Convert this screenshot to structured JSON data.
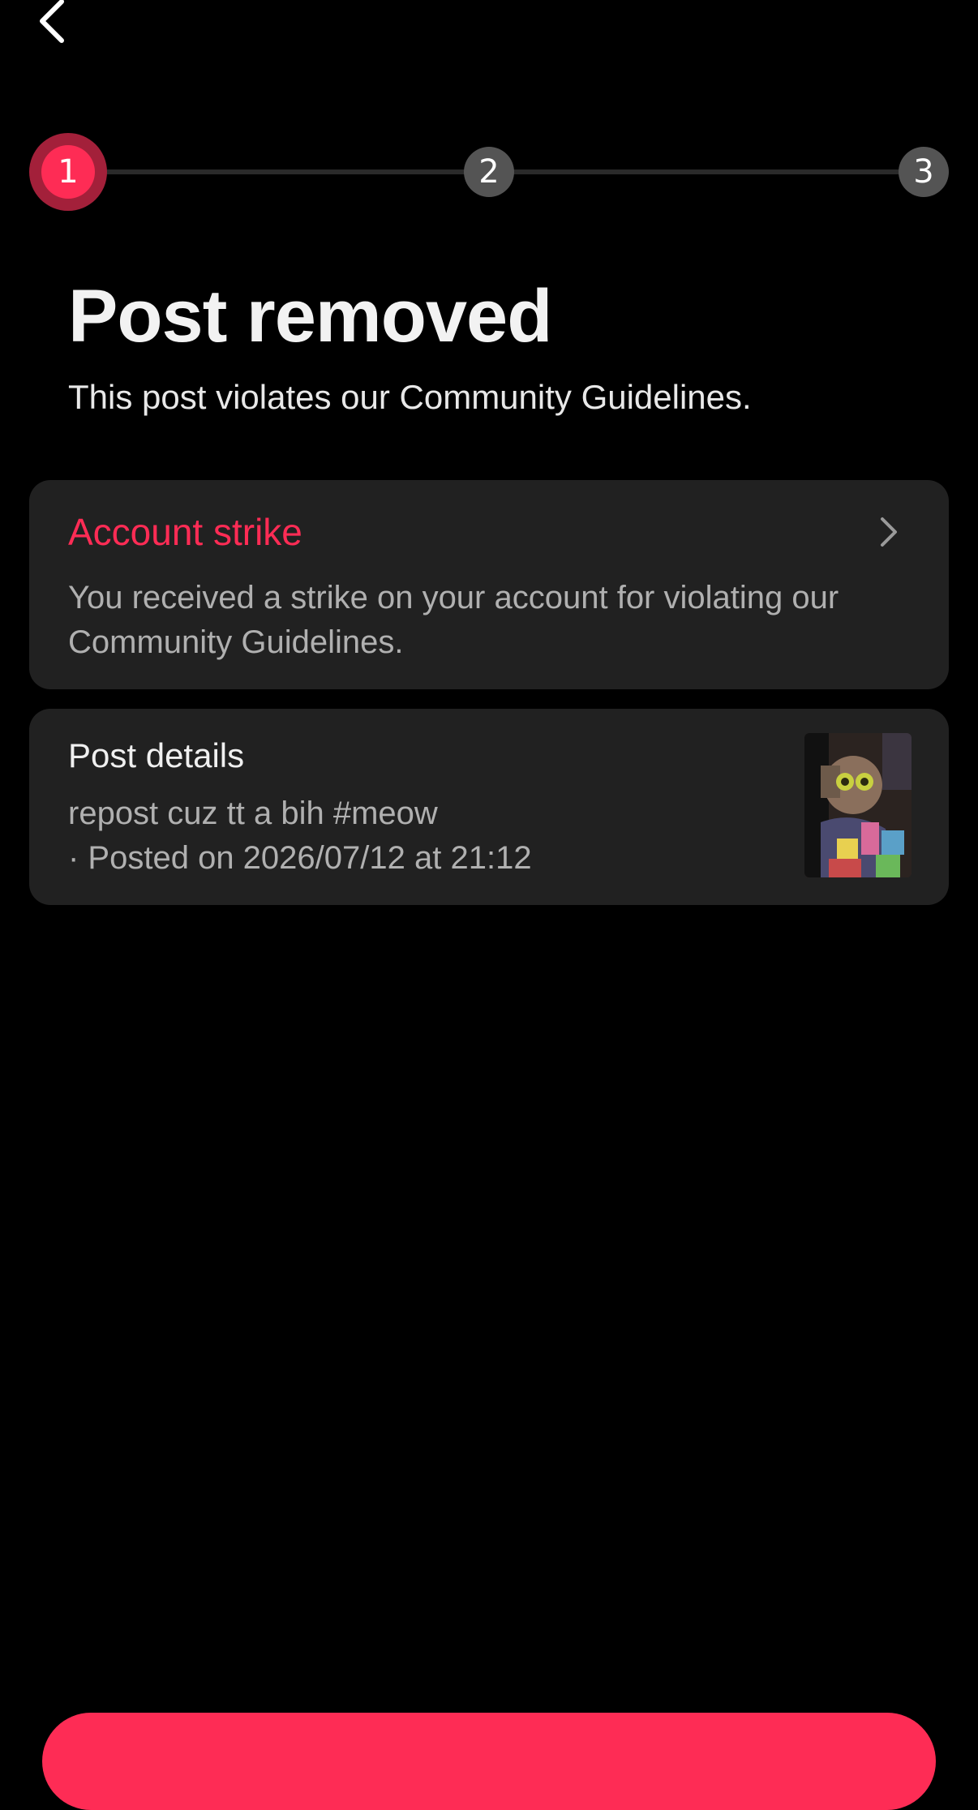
{
  "header": {
    "back_icon": "chevron-left-icon"
  },
  "stepper": {
    "steps": [
      {
        "label": "1",
        "state": "active"
      },
      {
        "label": "2",
        "state": "inactive"
      },
      {
        "label": "3",
        "state": "inactive"
      }
    ]
  },
  "main": {
    "title": "Post removed",
    "subtitle": "This post violates our Community Guidelines."
  },
  "account_strike": {
    "title": "Account strike",
    "body": "You received a strike on your account for violating our Community Guidelines.",
    "chevron_icon": "chevron-right-icon"
  },
  "post_details": {
    "title": "Post details",
    "caption": "repost cuz tt a bih #meow",
    "posted": "· Posted on 2026/07/12 at 21:12"
  },
  "colors": {
    "accent": "#fe2c55",
    "accent_dark": "#a3203a",
    "card_bg": "#212121",
    "inactive_step": "#545454",
    "background": "#000000"
  }
}
